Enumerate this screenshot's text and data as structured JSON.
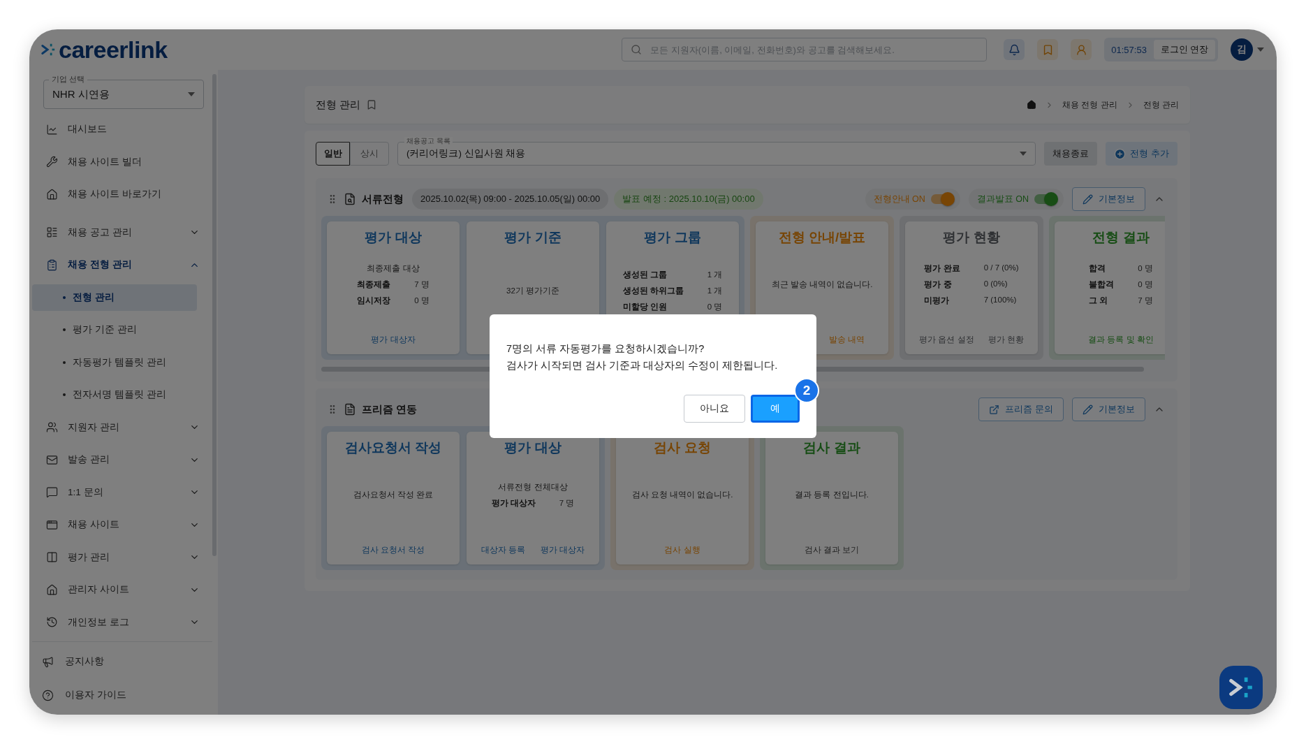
{
  "header": {
    "logo": "careerlink",
    "search_placeholder": "모든 지원자(이름, 이메일, 전화번호)와 공고를 검색해보세요.",
    "timer": "01:57:53",
    "extend_button": "로그인 연장",
    "avatar": "김"
  },
  "sidebar": {
    "company_select": {
      "label": "기업 선택",
      "value": "NHR 시연용"
    },
    "items": [
      {
        "label": "대시보드"
      },
      {
        "label": "채용 사이트 빌더"
      },
      {
        "label": "채용 사이트 바로가기"
      },
      {
        "label": "채용 공고 관리",
        "expanded": false
      },
      {
        "label": "채용 전형 관리",
        "expanded": true,
        "children": [
          {
            "label": "전형 관리",
            "selected": true
          },
          {
            "label": "평가 기준 관리",
            "selected": false
          },
          {
            "label": "자동평가 템플릿 관리",
            "selected": false
          },
          {
            "label": "전자서명 템플릿 관리",
            "selected": false
          }
        ]
      },
      {
        "label": "지원자 관리",
        "expanded": false
      },
      {
        "label": "발송 관리",
        "expanded": false
      },
      {
        "label": "1:1 문의",
        "expanded": false
      },
      {
        "label": "채용 사이트",
        "expanded": false
      },
      {
        "label": "평가 관리",
        "expanded": false
      },
      {
        "label": "관리자 사이트",
        "expanded": false
      },
      {
        "label": "개인정보 로그",
        "expanded": false
      }
    ],
    "footer_items": [
      {
        "label": "공지사항"
      },
      {
        "label": "이용자 가이드"
      }
    ]
  },
  "page": {
    "title": "전형 관리",
    "breadcrumb": [
      "채용 전형 관리",
      "전형 관리"
    ]
  },
  "toolbar": {
    "type_tabs": [
      {
        "label": "일반",
        "selected": true
      },
      {
        "label": "상시",
        "selected": false
      }
    ],
    "job_select": {
      "label": "채용공고 목록",
      "value": "(커리어링크) 신입사원 채용"
    },
    "close_button": "채용종료",
    "add_button": "전형 추가"
  },
  "stages": [
    {
      "name": "서류전형",
      "period": "2025.10.02(목) 09:00 - 2025.10.05(일) 00:00",
      "announce": "발표 예정 : 2025.10.10(금) 00:00",
      "expanded": true,
      "toggles": [
        {
          "label": "전형안내 ON",
          "on": true,
          "color": "#784505"
        },
        {
          "label": "결과발표 ON",
          "on": true,
          "color": "#184d15"
        }
      ],
      "buttons": [
        "기본정보"
      ],
      "groups": [
        {
          "kind": "evaluation",
          "cards": [
            {
              "title": "평가 대상",
              "subtitle": "최종제출 대상",
              "stats": [
                {
                  "label": "최종제출",
                  "value": "7 명"
                },
                {
                  "label": "임시저장",
                  "value": "0 명"
                }
              ],
              "links": [
                "평가 대상자"
              ]
            },
            {
              "title": "평가 기준",
              "note": "32기 평가기준"
            },
            {
              "title": "평가 그룹",
              "stats": [
                {
                  "label": "생성된 그룹",
                  "value": "1 개"
                },
                {
                  "label": "생성된 하위그룹",
                  "value": "1 개"
                },
                {
                  "label": "미할당 인원",
                  "value": "0 명"
                }
              ]
            }
          ]
        },
        {
          "kind": "notice",
          "cards": [
            {
              "title": "전형 안내/발표",
              "note": "최근 발송 내역이 없습니다.",
              "links": [
                "발송 내역"
              ],
              "links_right": true
            }
          ]
        },
        {
          "kind": "status",
          "cards": [
            {
              "title": "평가 현황",
              "stats": [
                {
                  "label": "평가 완료",
                  "value": "0 / 7 (0%)"
                },
                {
                  "label": "평가 중",
                  "value": "0 (0%)"
                },
                {
                  "label": "미평가",
                  "value": "7 (100%)"
                }
              ],
              "links": [
                "평가 옵션 설정",
                "평가 현황"
              ]
            }
          ]
        },
        {
          "kind": "result",
          "cards": [
            {
              "title": "전형 결과",
              "stats": [
                {
                  "label": "합격",
                  "value": "0 명"
                },
                {
                  "label": "불합격",
                  "value": "0 명"
                },
                {
                  "label": "그 외",
                  "value": "7 명"
                }
              ],
              "links": [
                "결과 등록 및 확인"
              ]
            }
          ]
        }
      ]
    },
    {
      "name": "프리즘 연동",
      "expanded": true,
      "buttons": [
        "프리즘 문의",
        "기본정보"
      ],
      "groups": [
        {
          "kind": "evaluation",
          "cards": [
            {
              "title": "검사요청서 작성",
              "note": "검사요청서 작성 완료",
              "links": [
                "검사 요청서 작성"
              ]
            },
            {
              "title": "평가 대상",
              "subtitle": "서류전형 전체대상",
              "stats": [
                {
                  "label": "평가 대상자",
                  "value": "7 명"
                }
              ],
              "links": [
                "대상자 등록",
                "평가 대상자"
              ]
            }
          ]
        },
        {
          "kind": "notice",
          "cards": [
            {
              "title": "검사 요청",
              "note": "검사 요청 내역이 없습니다.",
              "links": [
                "검사 실행"
              ]
            }
          ]
        },
        {
          "kind": "result",
          "cards": [
            {
              "title": "검사 결과",
              "note": "결과 등록 전입니다.",
              "links": [
                "검사 결과 보기"
              ],
              "muted_links": true
            }
          ]
        }
      ]
    }
  ],
  "modal": {
    "lines": [
      "7명의 서류 자동평가를 요청하시겠습니까?",
      "검사가 시작되면 검사 기준과 대상자의 수정이 제한됩니다."
    ],
    "buttons": [
      {
        "label": "아니요",
        "kind": "secondary",
        "focused": false
      },
      {
        "label": "예",
        "kind": "primary",
        "focused": true
      }
    ],
    "step_badge": "2"
  }
}
